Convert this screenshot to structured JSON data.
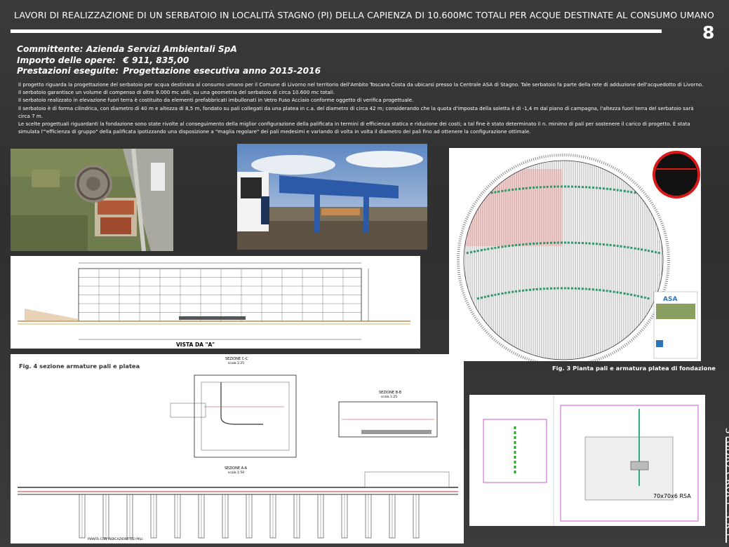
{
  "header": {
    "title": "LAVORI DI REALIZZAZIONE DI UN SERBATOIO IN LOCALITÀ STAGNO (PI) DELLA CAPIENZA DI 10.600MC TOTALI PER ACQUE DESTINATE AL CONSUMO UMANO",
    "page_number": "8"
  },
  "info": {
    "committente_label": "Committente:",
    "committente_value": "Azienda Servizi Ambientali SpA",
    "importo_label": "Importo delle opere:",
    "importo_value": "€ 911, 835,00",
    "prestazioni_label": "Prestazioni eseguite:",
    "prestazioni_value": "Progettazione esecutiva  anno 2015-2016"
  },
  "description": [
    " Il progetto riguarda la progettazione del serbatoio per acqua destinata al consumo umano per il Comune di Livorno nel territorio dell'Ambito Toscana Costa da ubicarsi presso la Centrale ASA di Stagno. Tale serbatoio fa parte della rete di adduzione dell'acquedotto di Livorno.",
    "Il serbatoio garantisce un volume di compenso di oltre 9.000 mc utili, su una geometria del serbatoio di circa 10.600 mc totali.",
    "Il serbatoio realizzato in elevazione fuori terra è costituito da elementi prefabbricati imbullonati in Vetro Fuso Acciaio conforme oggetto di verifica progettuale.",
    "Il serbatoio è di forma cilindrica, con diametro di 40 m e altezza di 8,5 m, fondato su pali collegati da una platea in c.a. del diametro di circa 42 m; considerando che la quota d'imposta della soletta è di -1,4 m dal piano di campagna, l'altezza fuori terra del serbatoio sarà circa 7 m.",
    "Le scelte progettuali riguardanti la fondazione sono state rivolte al conseguimento della miglior configurazione della palificata in termini di efficienza statica e riduzione dei costi; a tal fine  è stato  determinato il n. minimo di pali per sostenere il carico di progetto. È stata simulata l'\"efficienza di gruppo\" della palificata ipotizzando una disposizione a \"maglia regolare\" dei pali medesimi e variando di volta in volta il diametro dei pali fino ad ottenere la configurazione ottimale."
  ],
  "figures": {
    "elevation_label": "VISTA DA \"A\"",
    "fig3_caption": "Fig. 3  Pianta pali e armatura platea di fondazione",
    "fig4_caption": "Fig. 4 sezione armature pali e platea",
    "sez_cc": "SEZIONE C-C",
    "sez_cc_scale": "scala 1:25",
    "sez_bb": "SEZIONE B-B",
    "sez_bb_scale": "scala 1:25",
    "sez_aa": "SEZIONE A-A",
    "sez_aa_scale": "scala 1:50",
    "pianta_pali": "PIANTA CON INDICAZIONE DEI PALI",
    "detail_label": "70x70x6 RSA"
  },
  "footer": {
    "studio": "STUDIO CROCE S.R.L."
  }
}
